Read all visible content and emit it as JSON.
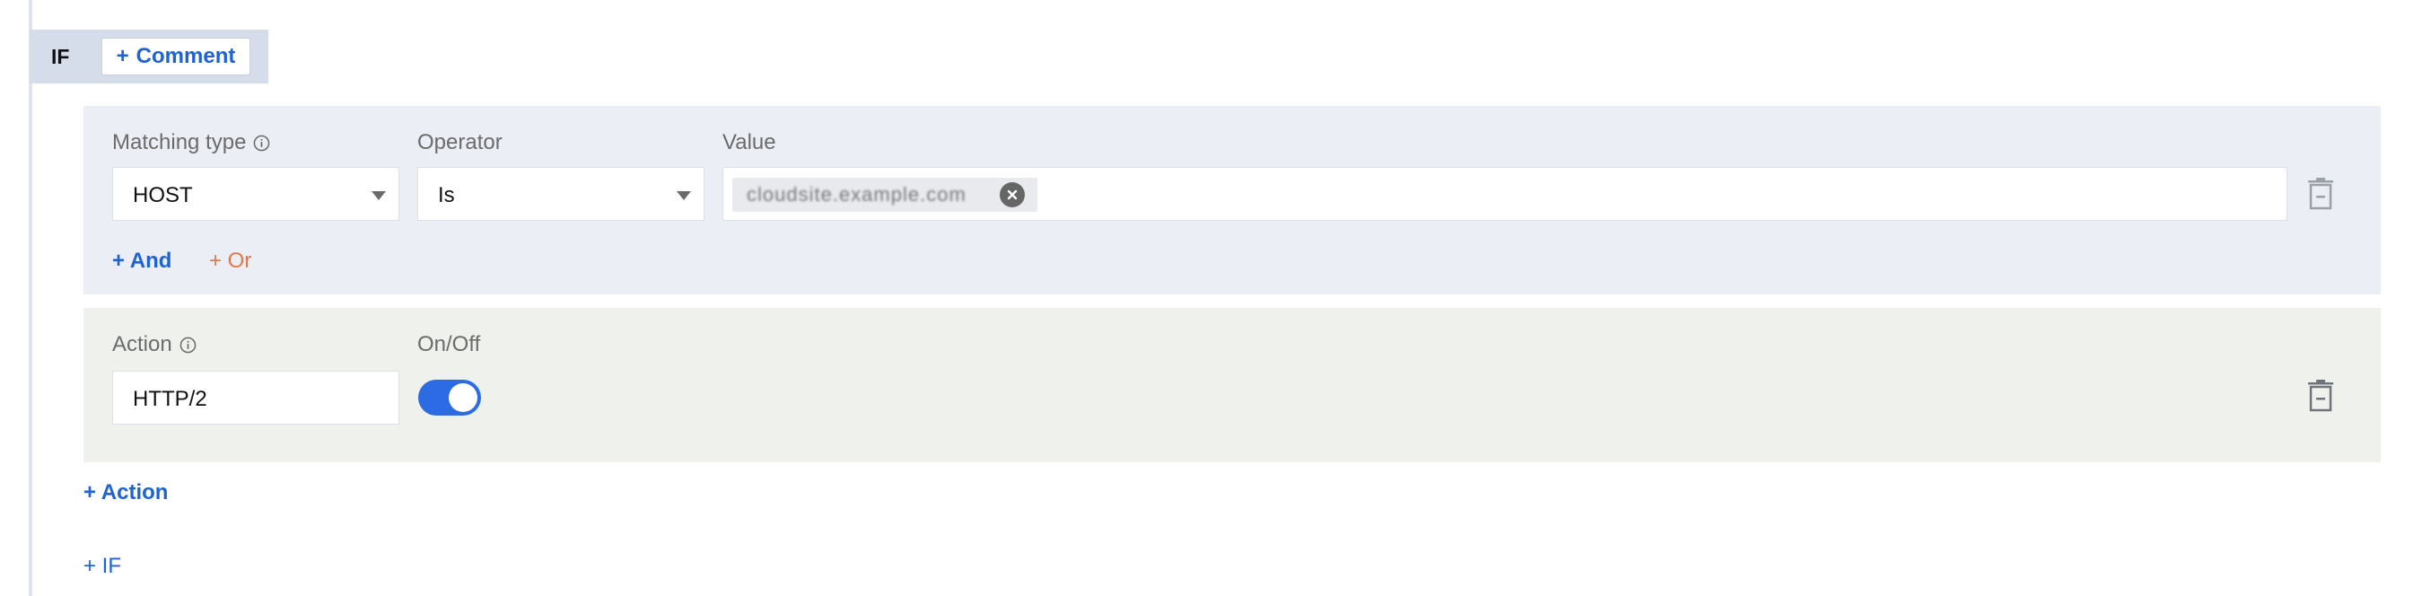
{
  "if_block": {
    "label": "IF",
    "comment_button": "Comment",
    "plus": "+"
  },
  "condition": {
    "matching_type": {
      "label": "Matching type",
      "value": "HOST"
    },
    "operator": {
      "label": "Operator",
      "value": "Is"
    },
    "value": {
      "label": "Value",
      "tags": [
        "cloudsite.example.com"
      ]
    },
    "and_link": "+ And",
    "or_link": "+ Or"
  },
  "action": {
    "action_field": {
      "label": "Action",
      "value": "HTTP/2"
    },
    "onoff": {
      "label": "On/Off",
      "state": "on"
    }
  },
  "add_action_link": "+ Action",
  "add_if_link": "+ IF",
  "colors": {
    "accent_blue": "#1e63d6",
    "or_orange": "#e1784d",
    "toggle_on": "#2d6be4",
    "condition_bg": "#ebeef4",
    "action_bg": "#eff2ec"
  }
}
